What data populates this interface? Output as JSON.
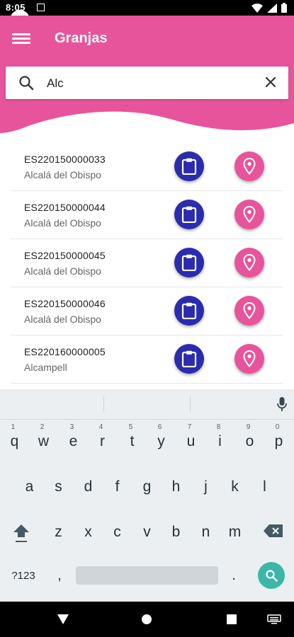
{
  "status_bar": {
    "time": "8:05"
  },
  "app_bar": {
    "title": "Granjas",
    "menu_icon": "menu-icon"
  },
  "search": {
    "value": "Alc",
    "search_icon": "search-icon",
    "clear_icon": "close-icon"
  },
  "farms": [
    {
      "code": "ES220150000033",
      "place": "Alcalá del Obispo"
    },
    {
      "code": "ES220150000044",
      "place": "Alcalá del Obispo"
    },
    {
      "code": "ES220150000045",
      "place": "Alcalá del Obispo"
    },
    {
      "code": "ES220150000046",
      "place": "Alcalá del Obispo"
    },
    {
      "code": "ES220160000005",
      "place": "Alcampell"
    }
  ],
  "row_actions": {
    "detail_icon": "clipboard-icon",
    "map_icon": "location-pin-icon"
  },
  "keyboard": {
    "row1": [
      "q",
      "w",
      "e",
      "r",
      "t",
      "y",
      "u",
      "i",
      "o",
      "p"
    ],
    "row1_hints": [
      "1",
      "2",
      "3",
      "4",
      "5",
      "6",
      "7",
      "8",
      "9",
      "0"
    ],
    "row2": [
      "a",
      "s",
      "d",
      "f",
      "g",
      "h",
      "j",
      "k",
      "l"
    ],
    "row3": [
      "z",
      "x",
      "c",
      "v",
      "b",
      "n",
      "m"
    ],
    "symbols_label": "?123",
    "comma": ",",
    "period": "."
  },
  "colors": {
    "primary_pink": "#e8549b",
    "fab_blue": "#2a2cae",
    "keyboard_bg": "#eceff1",
    "enter_teal": "#3bb7a8"
  }
}
